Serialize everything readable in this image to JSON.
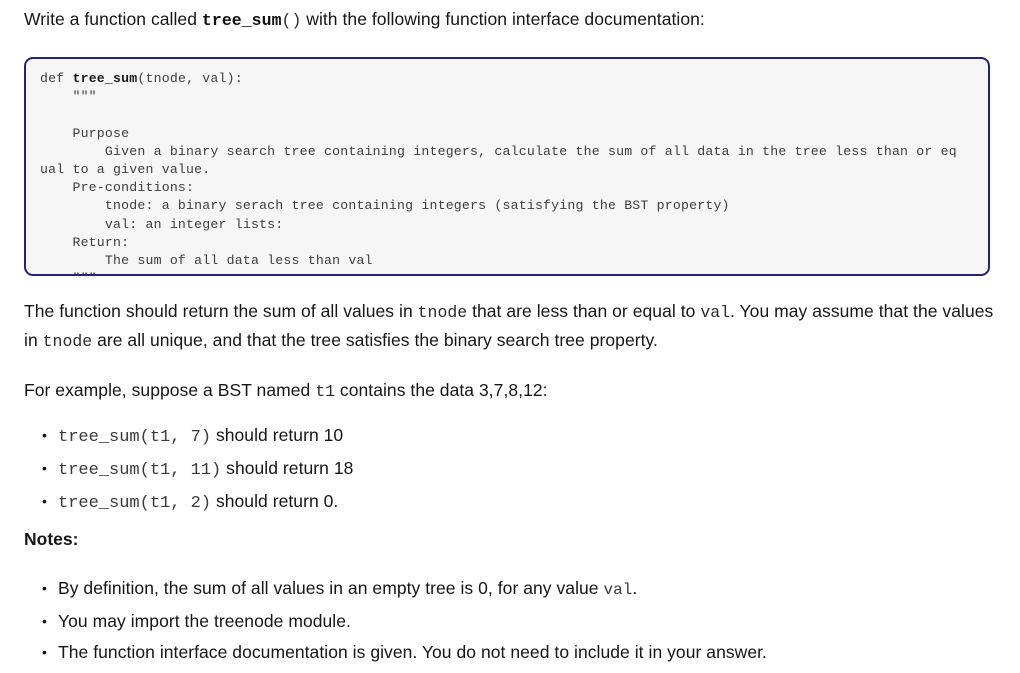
{
  "document": {
    "intro": {
      "before": "Write a function called ",
      "func_name": "tree_sum",
      "func_parens": "()",
      "after": " with the following function interface documentation:"
    },
    "code_block": {
      "language": "python",
      "border_color": "#23237a",
      "background_color": "#f6f6f6",
      "lines": [
        "def tree_sum(tnode, val):",
        "    \"\"\"",
        "",
        "    Purpose",
        "        Given a binary search tree containing integers, calculate the sum of all data in the tree less than or eq",
        "ual to a given value.",
        "    Pre-conditions:",
        "        tnode: a binary serach tree containing integers (satisfying the BST property)",
        "        val: an integer lists:",
        "    Return:",
        "        The sum of all data less than val",
        "    \"\"\"",
        ""
      ],
      "signature_keyword": "def ",
      "signature_bold_name": "tree_sum",
      "signature_rest": "(tnode, val):"
    },
    "description": {
      "p1_a": "The function should return the sum of all values in ",
      "p1_code1": "tnode",
      "p1_b": " that are less than or equal to ",
      "p1_code2": "val",
      "p1_c": ".  You may assume that the values in ",
      "p1_code3": "tnode",
      "p1_d": " are all unique, and that the tree satisfies the binary search tree property."
    },
    "example_intro": {
      "a": "For example, suppose a BST named ",
      "code": "t1",
      "b": " contains the data 3,7,8,12:"
    },
    "examples": [
      {
        "call": "tree_sum(t1, 7)",
        "text": " should return 10"
      },
      {
        "call": "tree_sum(t1, 11)",
        "text": " should return 18"
      },
      {
        "call": "tree_sum(t1, 2)",
        "text": " should return 0."
      }
    ],
    "notes_heading": "Notes:",
    "notes": [
      {
        "a": "By definition, the sum of all values in an empty tree is 0, for any value ",
        "code": "val",
        "b": "."
      },
      {
        "a": "You may import the treenode module.",
        "code": "",
        "b": ""
      },
      {
        "a": "The function interface documentation is given.  You do not need to include it in your answer.",
        "code": "",
        "b": ""
      }
    ]
  }
}
